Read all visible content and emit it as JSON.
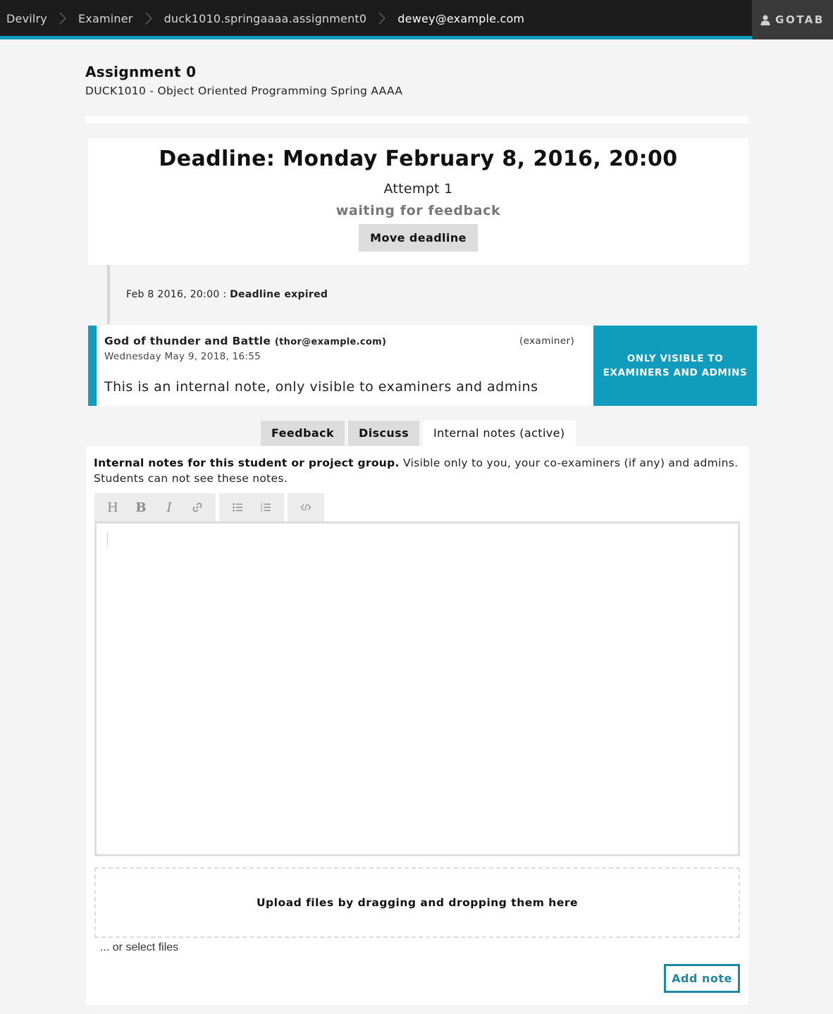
{
  "topbar": {
    "breadcrumbs": [
      {
        "label": "Devilry"
      },
      {
        "label": "Examiner"
      },
      {
        "label": "duck1010.springaaaa.assignment0"
      },
      {
        "label": "dewey@example.com"
      }
    ],
    "user_label": "GOTAB",
    "accent_color": "#0f9cbd"
  },
  "heading": {
    "title": "Assignment 0",
    "subtitle": "DUCK1010 - Object Oriented Programming Spring AAAA"
  },
  "deadline": {
    "title": "Deadline: Monday February 8, 2016, 20:00",
    "attempt": "Attempt 1",
    "status": "waiting for feedback",
    "move_button": "Move deadline"
  },
  "event": {
    "timestamp": "Feb 8 2016, 20:00",
    "separator": " : ",
    "message": "Deadline expired"
  },
  "note": {
    "author": "God of thunder and Battle",
    "email": "(thor@example.com)",
    "role": "(examiner)",
    "date": "Wednesday May 9, 2018, 16:55",
    "body": "This is an internal note, only visible to examiners and admins",
    "visibility_line1": "ONLY VISIBLE TO",
    "visibility_line2": "EXAMINERS AND ADMINS"
  },
  "tabs": [
    {
      "label": "Feedback",
      "active": false
    },
    {
      "label": "Discuss",
      "active": false
    },
    {
      "label": "Internal notes (active)",
      "active": true
    }
  ],
  "panel": {
    "intro_bold": "Internal notes for this student or project group.",
    "intro_rest": " Visible only to you, your co-examiners (if any) and admins. Students can not see these notes.",
    "toolbar": {
      "heading": "H",
      "bold": "B",
      "italic": "I",
      "link_icon": "link-icon",
      "bullet_icon": "bulleted-list-icon",
      "numbered_icon": "numbered-list-icon",
      "code_icon": "code-icon"
    },
    "editor_value": "",
    "dropzone_label": "Upload files by dragging and dropping them here",
    "select_files": "... or select files",
    "add_button": "Add note"
  }
}
